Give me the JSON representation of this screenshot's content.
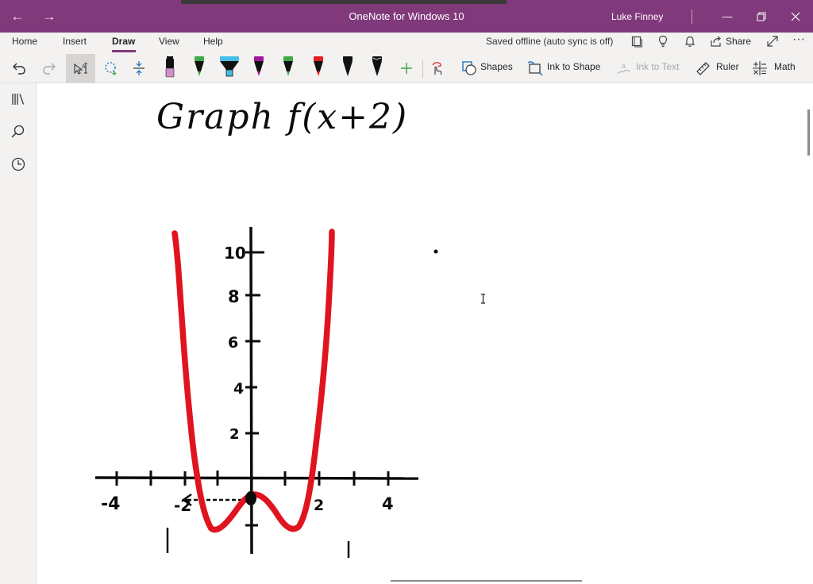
{
  "window": {
    "title": "OneNote for Windows 10",
    "user": "Luke Finney"
  },
  "ribbon": {
    "tabs": [
      {
        "label": "Home"
      },
      {
        "label": "Insert"
      },
      {
        "label": "Draw",
        "active": true
      },
      {
        "label": "View"
      },
      {
        "label": "Help"
      }
    ],
    "sync_status": "Saved offline (auto sync is off)",
    "share_label": "Share"
  },
  "toolbar": {
    "pens": [
      {
        "name": "pencil",
        "color": "#d18fce"
      },
      {
        "name": "pen",
        "color": "#3ea848"
      },
      {
        "name": "highlighter",
        "color": "#46bde6"
      },
      {
        "name": "pen",
        "color": "#a3159a"
      },
      {
        "name": "pen",
        "color": "#3ea848"
      },
      {
        "name": "pen",
        "color": "#e0201c"
      },
      {
        "name": "pen",
        "color": "#111111"
      },
      {
        "name": "pen",
        "color": "#111111"
      }
    ],
    "shapes_label": "Shapes",
    "ink_to_shape_label": "Ink to Shape",
    "ink_to_text_label": "Ink to Text",
    "ruler_label": "Ruler",
    "math_label": "Math"
  },
  "ink": {
    "heading": "Graph f(x+2)",
    "y_tick_labels": [
      "10",
      "8",
      "6",
      "4",
      "2"
    ],
    "x_tick_labels": [
      "-4",
      "-2",
      "2",
      "4"
    ],
    "ink_red": "#e0141f",
    "ink_black": "#0b0b0b"
  }
}
